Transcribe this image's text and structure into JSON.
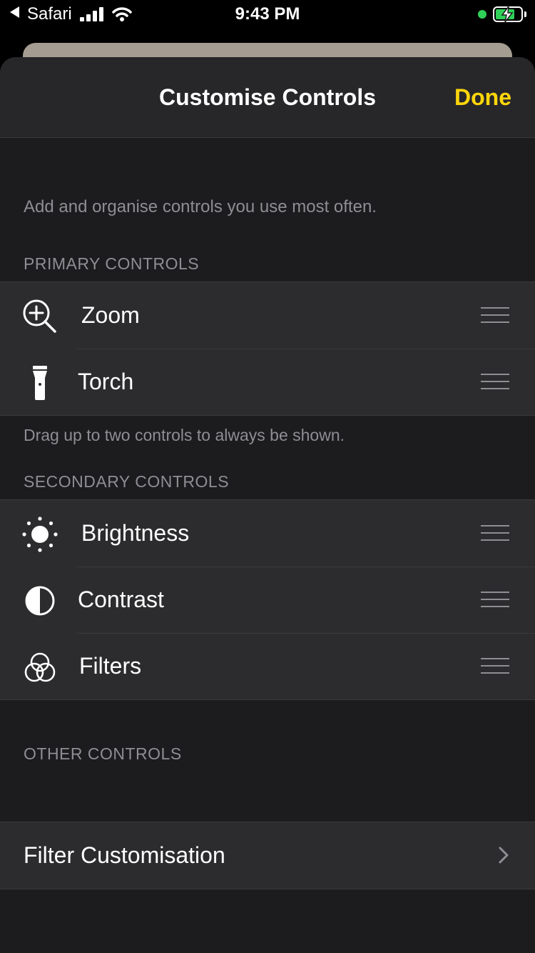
{
  "status_bar": {
    "back_app": "Safari",
    "time": "9:43 PM"
  },
  "sheet": {
    "title": "Customise Controls",
    "done_label": "Done",
    "description": "Add and organise controls you use most often.",
    "primary": {
      "header": "PRIMARY CONTROLS",
      "items": [
        {
          "label": "Zoom",
          "icon": "zoom-in-icon"
        },
        {
          "label": "Torch",
          "icon": "flashlight-icon"
        }
      ],
      "footer": "Drag up to two controls to always be shown."
    },
    "secondary": {
      "header": "SECONDARY CONTROLS",
      "items": [
        {
          "label": "Brightness",
          "icon": "sun-icon"
        },
        {
          "label": "Contrast",
          "icon": "contrast-icon"
        },
        {
          "label": "Filters",
          "icon": "filters-icon"
        }
      ]
    },
    "other": {
      "header": "OTHER CONTROLS",
      "items": [
        {
          "label": "Filter Customisation",
          "icon": "chevron-right-icon"
        }
      ]
    }
  },
  "colors": {
    "accent": "#ffd60a",
    "background": "#1c1c1e",
    "row_background": "#2c2c2e",
    "secondary_text": "#8e8e93"
  }
}
